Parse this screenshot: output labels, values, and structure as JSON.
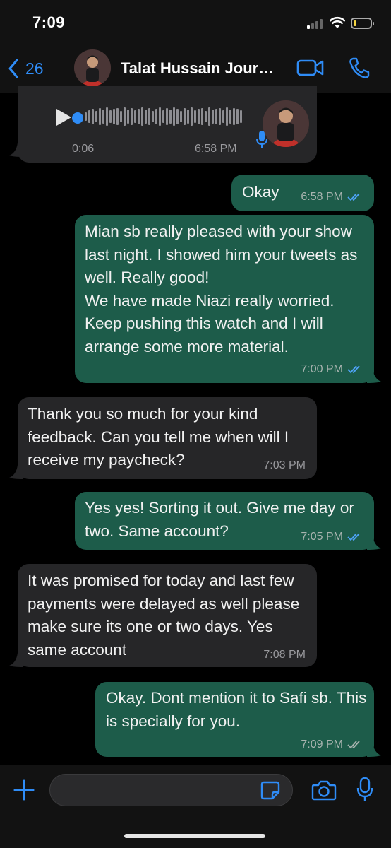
{
  "status_bar": {
    "time": "7:09",
    "battery_level": 0.2,
    "battery_color": "#f6d743"
  },
  "header": {
    "back_count": "26",
    "contact_name": "Talat Hussain Jour…",
    "back_icon": "chevron-left-icon",
    "video_icon": "video-camera-icon",
    "phone_icon": "phone-icon",
    "accent_color": "#2f8cf6"
  },
  "messages": [
    {
      "direction": "incoming",
      "type": "voice",
      "duration": "0:06",
      "time": "6:58 PM"
    },
    {
      "direction": "outgoing",
      "text": "Okay",
      "time": "6:58 PM",
      "status": "read"
    },
    {
      "direction": "outgoing",
      "text": "Mian sb really pleased with your show last night. I showed him your tweets as well. Really good!\nWe have made Niazi really worried. Keep pushing this watch and I will arrange some more material.",
      "time": "7:00 PM",
      "status": "read"
    },
    {
      "direction": "incoming",
      "text": "Thank you so much for your kind feedback. Can you tell me when will I receive my paycheck?",
      "time": "7:03 PM"
    },
    {
      "direction": "outgoing",
      "text": "Yes yes! Sorting it out. Give me day or two. Same account?",
      "time": "7:05 PM",
      "status": "read"
    },
    {
      "direction": "incoming",
      "text": "It was promised for today  and last few payments were delayed as well please make sure its one or two days. Yes same account",
      "time": "7:08 PM"
    },
    {
      "direction": "outgoing",
      "text": "Okay. Dont mention it to Safi sb. This is specially for you.",
      "time": "7:09 PM",
      "status": "delivered"
    }
  ],
  "input_bar": {
    "placeholder": "",
    "value": "",
    "icons": [
      "plus-icon",
      "sticker-icon",
      "camera-icon",
      "microphone-icon"
    ]
  },
  "colors": {
    "incoming_bubble": "#262628",
    "outgoing_bubble": "#1d5c4a",
    "read_tick": "#4fa3f7",
    "delivered_tick": "#a9b4b0"
  }
}
